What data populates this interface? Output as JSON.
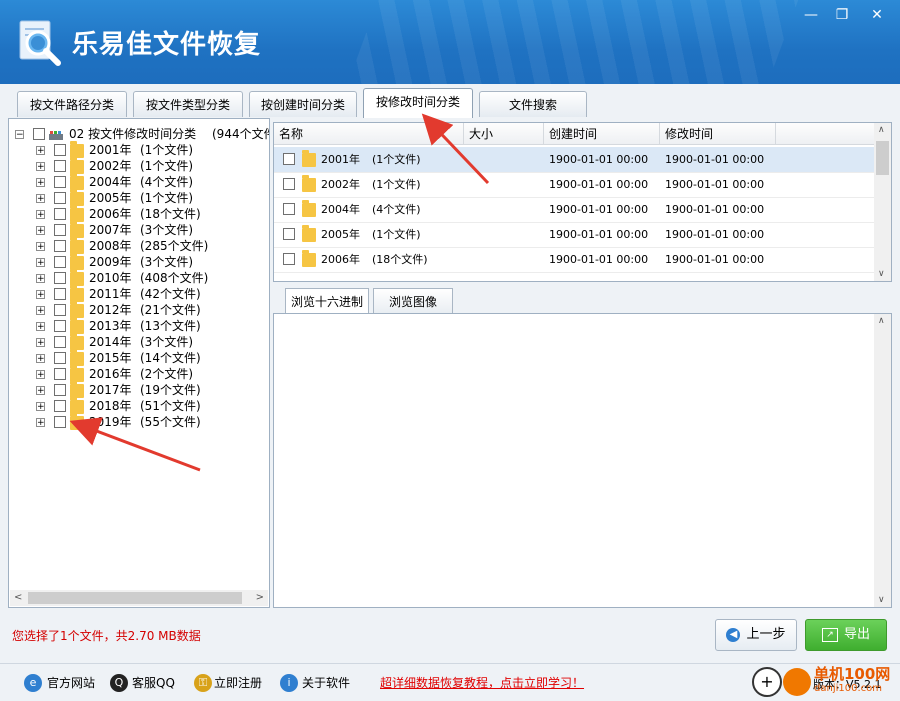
{
  "window": {
    "title": "乐易佳文件恢复",
    "controls": {
      "minimize": "—",
      "restore": "❐",
      "close": "✕"
    }
  },
  "tabs": [
    {
      "label": "按文件路径分类",
      "active": false
    },
    {
      "label": "按文件类型分类",
      "active": false
    },
    {
      "label": "按创建时间分类",
      "active": false
    },
    {
      "label": "按修改时间分类",
      "active": true
    },
    {
      "label": "文件搜索",
      "active": false
    }
  ],
  "tree": {
    "root": {
      "label": "02  按文件修改时间分类",
      "count": "(944个文件"
    },
    "items": [
      {
        "year": "2001年",
        "count": "(1个文件)"
      },
      {
        "year": "2002年",
        "count": "(1个文件)"
      },
      {
        "year": "2004年",
        "count": "(4个文件)"
      },
      {
        "year": "2005年",
        "count": "(1个文件)"
      },
      {
        "year": "2006年",
        "count": "(18个文件)"
      },
      {
        "year": "2007年",
        "count": "(3个文件)"
      },
      {
        "year": "2008年",
        "count": "(285个文件)"
      },
      {
        "year": "2009年",
        "count": "(3个文件)"
      },
      {
        "year": "2010年",
        "count": "(408个文件)"
      },
      {
        "year": "2011年",
        "count": "(42个文件)"
      },
      {
        "year": "2012年",
        "count": "(21个文件)"
      },
      {
        "year": "2013年",
        "count": "(13个文件)"
      },
      {
        "year": "2014年",
        "count": "(3个文件)"
      },
      {
        "year": "2015年",
        "count": "(14个文件)"
      },
      {
        "year": "2016年",
        "count": "(2个文件)"
      },
      {
        "year": "2017年",
        "count": "(19个文件)"
      },
      {
        "year": "2018年",
        "count": "(51个文件)"
      },
      {
        "year": "2019年",
        "count": "(55个文件)"
      }
    ]
  },
  "list": {
    "columns": {
      "name": "名称",
      "size": "大小",
      "created": "创建时间",
      "modified": "修改时间"
    },
    "rows": [
      {
        "name": "2001年",
        "count": "(1个文件)",
        "size": "",
        "created": "1900-01-01  00:00",
        "modified": "1900-01-01  00:00",
        "selected": true
      },
      {
        "name": "2002年",
        "count": "(1个文件)",
        "size": "",
        "created": "1900-01-01  00:00",
        "modified": "1900-01-01  00:00",
        "selected": false
      },
      {
        "name": "2004年",
        "count": "(4个文件)",
        "size": "",
        "created": "1900-01-01  00:00",
        "modified": "1900-01-01  00:00",
        "selected": false
      },
      {
        "name": "2005年",
        "count": "(1个文件)",
        "size": "",
        "created": "1900-01-01  00:00",
        "modified": "1900-01-01  00:00",
        "selected": false
      },
      {
        "name": "2006年",
        "count": "(18个文件)",
        "size": "",
        "created": "1900-01-01  00:00",
        "modified": "1900-01-01  00:00",
        "selected": false
      }
    ]
  },
  "preview": {
    "tabs": [
      {
        "label": "浏览十六进制",
        "active": true
      },
      {
        "label": "浏览图像",
        "active": false
      }
    ]
  },
  "status": {
    "text": "您选择了1个文件，共2.70 MB数据"
  },
  "actions": {
    "back": "上一步",
    "export": "导出"
  },
  "footer": {
    "links": [
      "官方网站",
      "客服QQ",
      "立即注册",
      "关于软件"
    ],
    "promo": "超详细数据恢复教程，点击立即学习！",
    "version": "版本：V5.2.1",
    "watermark": "单机100网",
    "watermark_url": "danji100.com"
  },
  "colors": {
    "titlebar": "#2080cf",
    "status_red": "#d40000",
    "export_green": "#3fae2f",
    "promo_red": "#e00000"
  }
}
